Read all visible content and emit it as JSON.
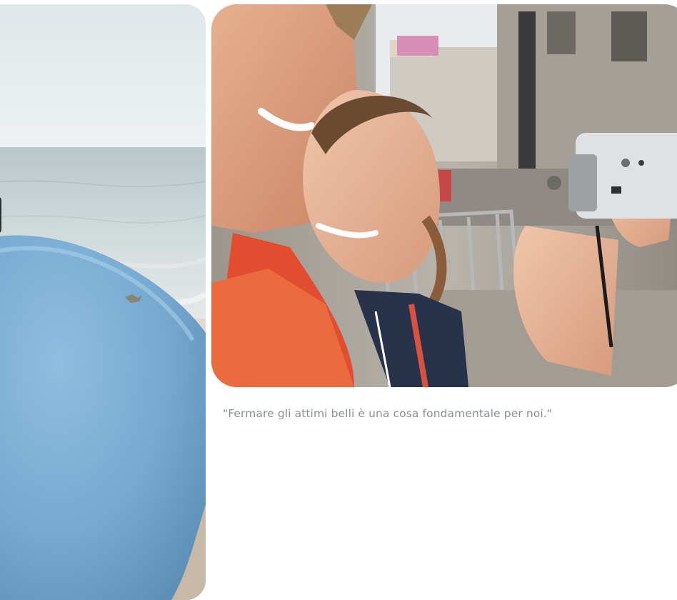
{
  "images": {
    "left": {
      "icon": "beach-surfboard-photo"
    },
    "right": {
      "icon": "couple-camcorder-photo"
    }
  },
  "caption": {
    "text": "\"Fermare gli attimi belli è una cosa fondamentale per noi.\""
  },
  "colors": {
    "caption": "#8a9096",
    "sky": "#e9eef0",
    "sea": "#c9d3d6",
    "surfboard": "#7fb0d6",
    "sand": "#d9cfc1"
  }
}
